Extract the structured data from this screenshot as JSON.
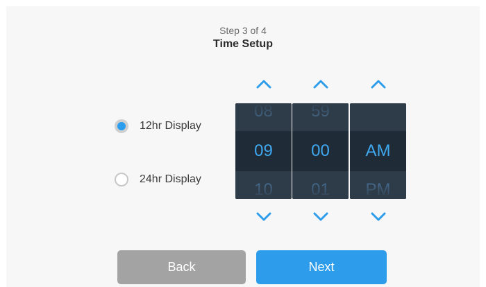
{
  "header": {
    "step": "Step 3 of 4",
    "title": "Time Setup"
  },
  "display_options": [
    {
      "label": "12hr Display",
      "selected": true
    },
    {
      "label": "24hr Display",
      "selected": false
    }
  ],
  "time_picker": {
    "hour": {
      "prev": "08",
      "value": "09",
      "next": "10"
    },
    "minute": {
      "prev": "59",
      "value": "00",
      "next": "01"
    },
    "period": {
      "prev": "",
      "value": "AM",
      "next": "PM"
    }
  },
  "buttons": {
    "back": "Back",
    "next": "Next"
  },
  "icons": {
    "increment": "chevron-up-icon",
    "decrement": "chevron-down-icon",
    "radio_selected": "radio-selected-icon",
    "radio_unselected": "radio-unselected-icon"
  },
  "colors": {
    "accent": "#2d9ceb",
    "picker_bg": "#2e3c49",
    "picker_band": "#1f2c38",
    "back_button": "#a3a3a3",
    "panel_bg": "#f7f7f7"
  }
}
